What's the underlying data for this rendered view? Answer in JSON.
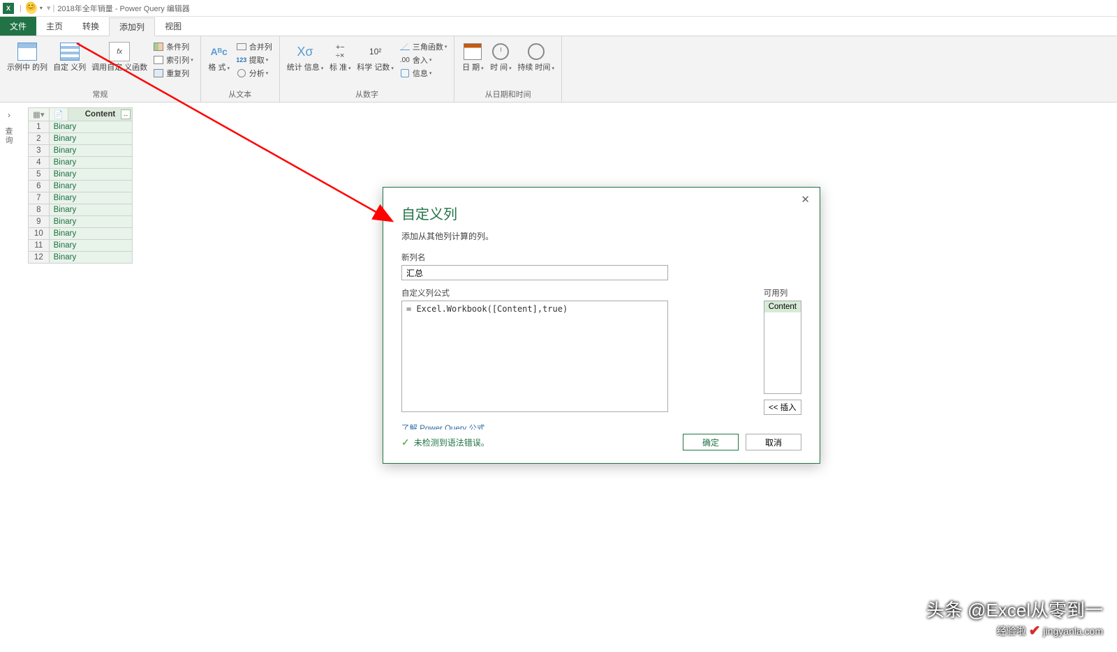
{
  "title": {
    "app": "2018年全年销量 - Power Query 编辑器"
  },
  "tabs": {
    "file": "文件",
    "home": "主页",
    "transform": "转换",
    "addcol": "添加列",
    "view": "视图"
  },
  "ribbon": {
    "group_general": "常规",
    "example_col": "示例中\n的列",
    "custom_col": "自定\n义列",
    "invoke_fn": "调用自定\n义函数",
    "cond_col": "条件列",
    "index_col": "索引列",
    "dup_col": "重复列",
    "group_text": "从文本",
    "format": "格\n式",
    "merge_col": "合并列",
    "extract": "提取",
    "parse": "分析",
    "group_number": "从数字",
    "stats": "统计\n信息",
    "standard": "标\n准",
    "sci": "科学\n记数",
    "trig": "三角函数",
    "round": "舍入",
    "info": "信息",
    "group_datetime": "从日期和时间",
    "date": "日\n期",
    "time": "时\n间",
    "duration": "持续\n时间"
  },
  "left_panel": {
    "label": "查询"
  },
  "table": {
    "col_header": "Content",
    "rows": [
      "Binary",
      "Binary",
      "Binary",
      "Binary",
      "Binary",
      "Binary",
      "Binary",
      "Binary",
      "Binary",
      "Binary",
      "Binary",
      "Binary"
    ]
  },
  "dialog": {
    "title": "自定义列",
    "subtitle": "添加从其他列计算的列。",
    "name_label": "新列名",
    "name_value": "汇总",
    "formula_label": "自定义列公式",
    "formula_value": "= Excel.Workbook([Content],true)",
    "avail_label": "可用列",
    "avail_item": "Content",
    "insert": "<< 插入",
    "link": "了解 Power Query 公式",
    "status": "未检测到语法错误。",
    "ok": "确定",
    "cancel": "取消"
  },
  "watermark": {
    "line1": "头条 @Excel从零到一",
    "line2_pre": "经验啦",
    "line2_suf": "jingyanla.com"
  }
}
